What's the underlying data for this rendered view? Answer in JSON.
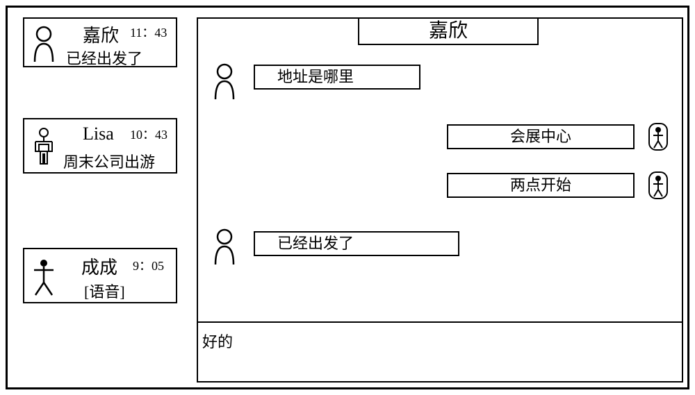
{
  "conversations": [
    {
      "name": "嘉欣",
      "time": "11：43",
      "preview": "已经出发了",
      "avatar": "person"
    },
    {
      "name": "Lisa",
      "time": "10：43",
      "preview": "周末公司出游",
      "avatar": "outline-person"
    },
    {
      "name": "成成",
      "time": "9：05",
      "preview": "[语音]",
      "avatar": "stick-person"
    }
  ],
  "chat": {
    "title": "嘉欣",
    "messages": [
      {
        "side": "left",
        "text": "地址是哪里"
      },
      {
        "side": "right",
        "text": "会展中心"
      },
      {
        "side": "right",
        "text": "两点开始"
      },
      {
        "side": "left",
        "text": "已经出发了"
      }
    ],
    "input_draft": "好的"
  }
}
